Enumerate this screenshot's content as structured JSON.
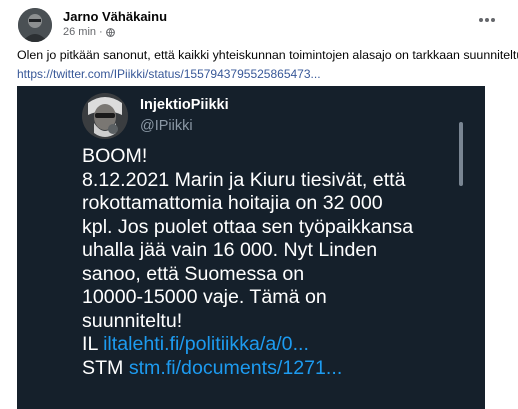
{
  "post": {
    "author": "Jarno Vähäkainu",
    "time": "26 min",
    "time_sep": "·",
    "globe_icon": "globe-icon",
    "more_icon": "more-options-icon",
    "text": "Olen jo pitkään sanonut, että kaikki yhteiskunnan toimintojen alasajo on tarkkaan suunniteltu👇",
    "link": "https://twitter.com/IPiikki/status/1557943795525865473..."
  },
  "tweet": {
    "name": "InjektioPiikki",
    "handle": "@IPiikki",
    "lines": [
      "BOOM!",
      "8.12.2021 Marin ja Kiuru tiesivät, että",
      "rokottamattomia hoitajia on 32 000",
      "kpl. Jos puolet ottaa sen työpaikkansa",
      "uhalla jää vain 16 000. Nyt Linden",
      "sanoo, että Suomessa on",
      "10000-15000 vaje. Tämä on",
      "suunniteltu!"
    ],
    "il_label": "IL",
    "il_link": "iltalehti.fi/politiikka/a/0...",
    "stm_label": "STM",
    "stm_link": "stm.fi/documents/1271..."
  },
  "colors": {
    "tweet_bg": "#15202b",
    "link_blue": "#1d9bf0",
    "fb_link": "#385898"
  }
}
